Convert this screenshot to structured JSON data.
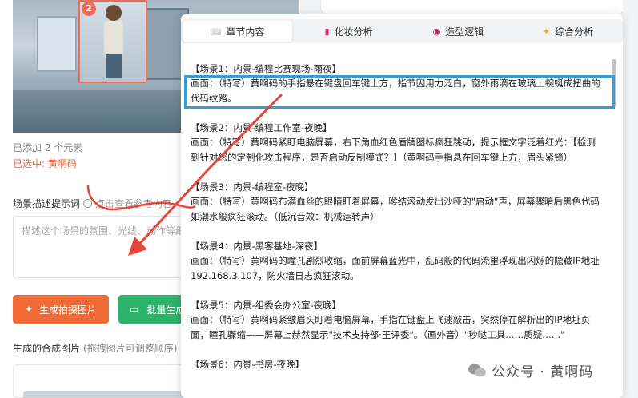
{
  "left": {
    "badge_count": "2",
    "added_text": "已添加 2 个元素",
    "selected_text": "已选中: 黄啊码",
    "prompt_label": "场景描述提示词",
    "prompt_hint": "点击查看参考内容",
    "prompt_placeholder": "描述这个场景的氛围、光线、动作等细节",
    "generate_button": "生成拍摄图片",
    "batch_button": "批量生成",
    "composite_label": "生成的合成图片",
    "composite_hint": "(拖拽图片可调整顺序)"
  },
  "tabs": [
    {
      "label": "章节内容",
      "icon": "book-icon"
    },
    {
      "label": "化妆分析",
      "icon": "lipstick-icon"
    },
    {
      "label": "造型逻辑",
      "icon": "palette-icon"
    },
    {
      "label": "综合分析",
      "icon": "sparkle-icon"
    }
  ],
  "scenes": [
    {
      "title": "【场景1：内景-编程比赛现场-雨夜】",
      "body": "画面：（特写）黄啊码的手指悬在键盘回车键上方，指节因用力泛白，窗外雨滴在玻璃上蜿蜒成扭曲的代码纹路。"
    },
    {
      "title": "【场景2：内景-编程工作室-夜晚】",
      "body": "画面：（特写）黄啊码紧盯电脑屏幕，右下角血红色盾牌图标疯狂跳动，提示框文字泛着红光：【检测到针对您的定制化攻击程序，是否启动反制模式？】（黄啊码手指悬在回车键上方，眉头紧锁）"
    },
    {
      "title": "【场景3：内景-编程室-夜晚】",
      "body": "画面：（特写）黄啊码布满血丝的眼睛盯着屏幕，喉结滚动发出沙哑的\"启动\"声，屏幕骤暗后黑色代码如潮水般疯狂滚动。（低沉音效：机械运转声）"
    },
    {
      "title": "【场景4：内景-黑客基地-深夜】",
      "body": "画面：（特写）黄啊码的瞳孔剧烈收缩，面前屏幕蓝光中，乱码般的代码流里浮现出闪烁的隐藏IP地址192.168.3.107，防火墙日志疯狂滚动。"
    },
    {
      "title": "【场景5：内景-组委会办公室-夜晚】",
      "body": "画面：（特写）黄啊码紧皱眉头盯着电脑屏幕，手指在键盘上飞速敲击，突然停在解析出的IP地址页面，瞳孔骤缩——屏幕上赫然显示\"技术支持部·王评委\"。（画外音）\"秒哒工具……质疑……\""
    },
    {
      "title": "【场景6：内景-书房-夜晚】",
      "body": ""
    }
  ],
  "watermark": "公众号 · 黄啊码",
  "colors": {
    "accent_orange": "#f06a35",
    "accent_green": "#2bb36a",
    "highlight_blue": "#2d9fd9",
    "annotation_red": "#e8443a"
  }
}
